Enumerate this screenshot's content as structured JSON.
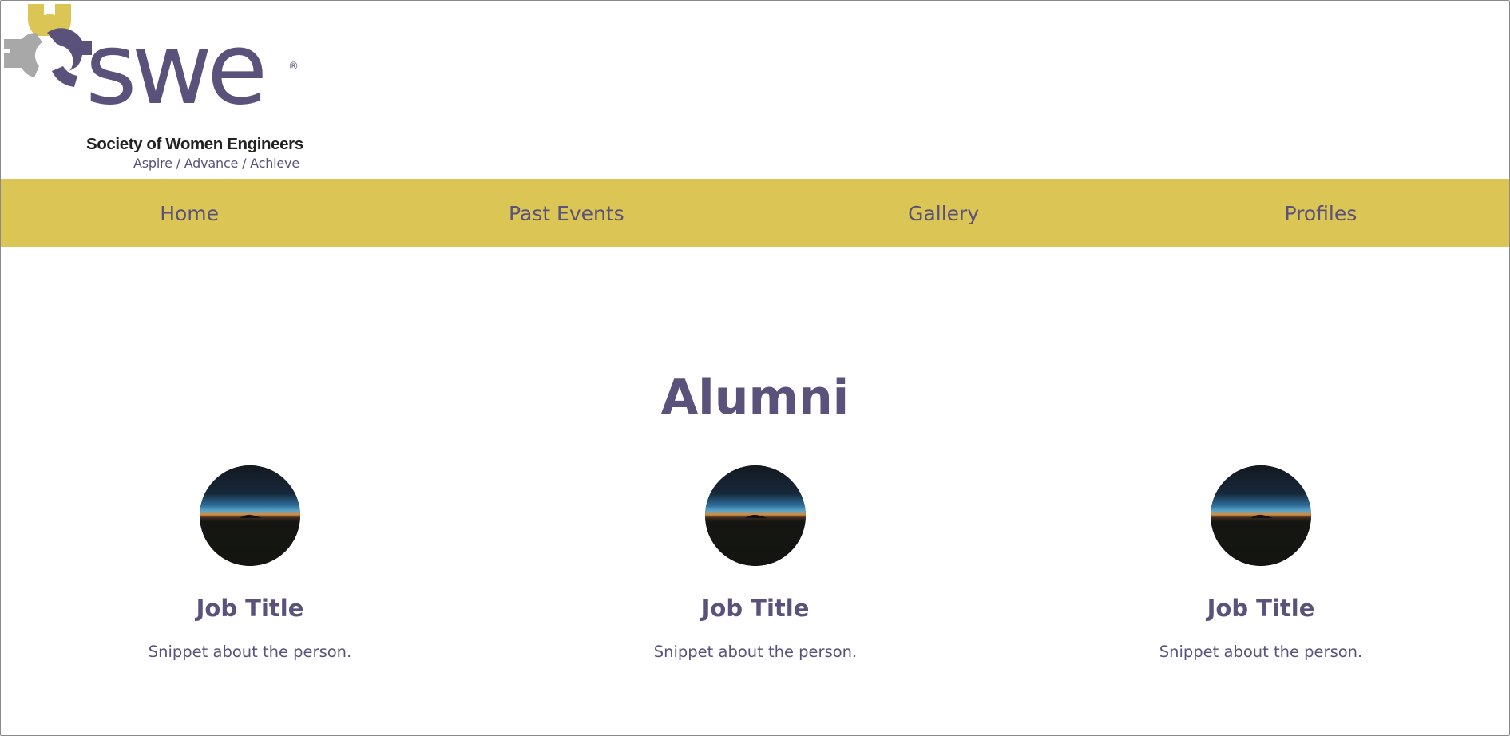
{
  "colors": {
    "brand_purple": "#5a527a",
    "brand_gold": "#dbc554",
    "brand_gray": "#a8a8a8",
    "background": "#ffffff"
  },
  "logo": {
    "wordmark": "swe",
    "registered": "®",
    "organization": "Society of Women Engineers",
    "tagline": "Aspire / Advance / Achieve",
    "icon": "gear-icon"
  },
  "nav": {
    "items": [
      {
        "label": "Home"
      },
      {
        "label": "Past Events"
      },
      {
        "label": "Gallery"
      },
      {
        "label": "Profiles"
      }
    ]
  },
  "main": {
    "title": "Alumni",
    "profiles": [
      {
        "job_title": "Job Title",
        "snippet": "Snippet about the person.",
        "image": "horizon-sunset-photo"
      },
      {
        "job_title": "Job Title",
        "snippet": "Snippet about the person.",
        "image": "horizon-sunset-photo"
      },
      {
        "job_title": "Job Title",
        "snippet": "Snippet about the person.",
        "image": "horizon-sunset-photo"
      }
    ]
  }
}
